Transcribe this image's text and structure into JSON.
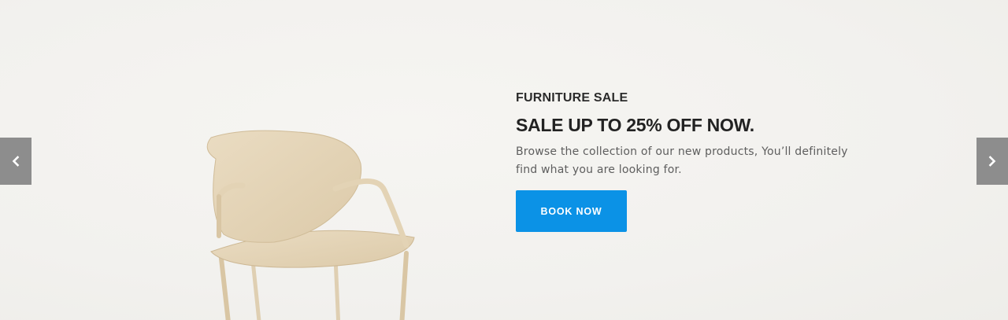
{
  "hero": {
    "eyebrow": "FURNITURE SALE",
    "headline": "SALE UP TO 25% OFF NOW.",
    "description_line1": "Browse the collection of our new products, You’ll definitely",
    "description_line2": "find what you are looking for.",
    "cta_label": "BOOK NOW"
  },
  "slider": {
    "prev_icon": "chevron-left-icon",
    "next_icon": "chevron-right-icon"
  },
  "colors": {
    "accent": "#0b92e6",
    "nav_bg": "#8d8d8d",
    "background": "#f2f1ee",
    "heading": "#222222",
    "body_text": "#5e5e5e"
  }
}
